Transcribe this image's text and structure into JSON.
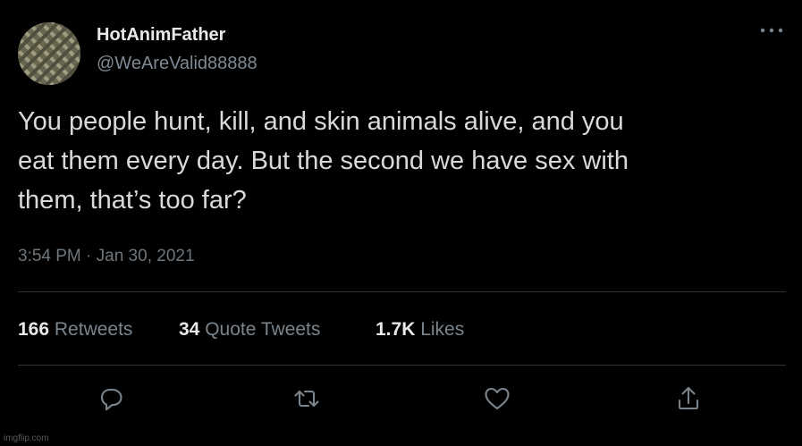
{
  "author": {
    "display_name": "HotAnimFather",
    "handle": "@WeAreValid88888",
    "avatar_icon": "avatar-image"
  },
  "more_icon": "more-horizontal-icon",
  "tweet": {
    "text": "You people hunt, kill, and skin animals alive, and you\neat them every day.  But the second we have sex with\nthem, that’s too far?",
    "timestamp": "3:54 PM · Jan 30, 2021"
  },
  "stats": {
    "retweets": {
      "count": "166",
      "label": "Retweets"
    },
    "quote_tweets": {
      "count": "34",
      "label": "Quote Tweets"
    },
    "likes": {
      "count": "1.7K",
      "label": "Likes"
    }
  },
  "actions": {
    "reply_icon": "reply-bubble-icon",
    "retweet_icon": "retweet-arrows-icon",
    "like_icon": "heart-icon",
    "share_icon": "share-upload-icon"
  },
  "watermark": "imgflip.com",
  "colors": {
    "background": "#000000",
    "primary_text": "#d9d9d9",
    "secondary_text": "#6e767d",
    "divider": "#2f3336",
    "icon": "#7a848c"
  }
}
